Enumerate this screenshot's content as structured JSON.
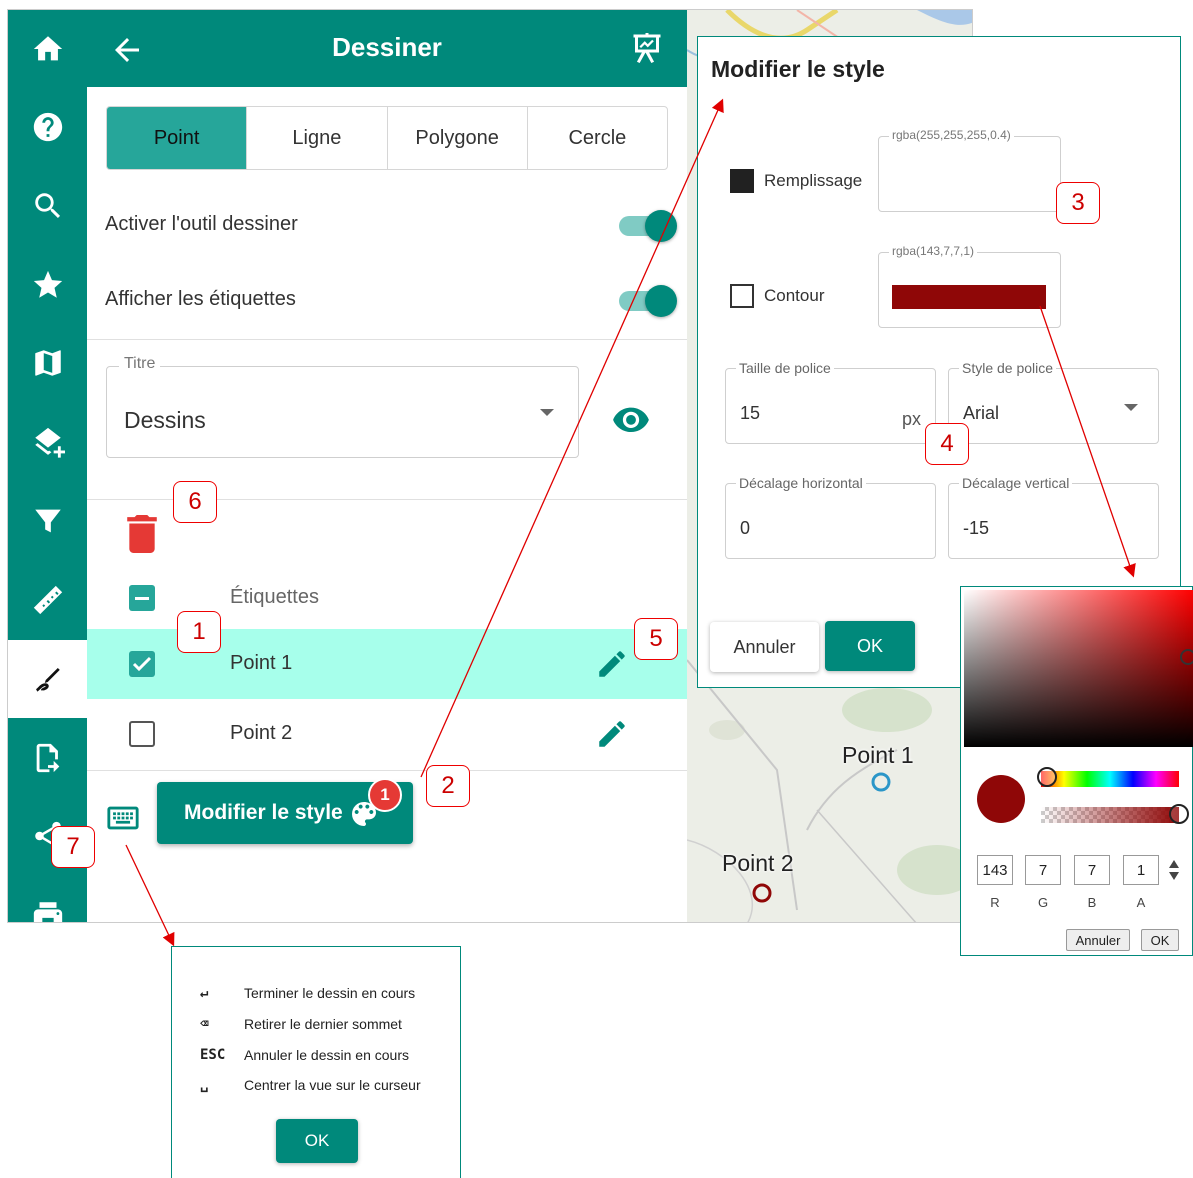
{
  "header": {
    "title": "Dessiner"
  },
  "tabs": [
    {
      "label": "Point",
      "active": true
    },
    {
      "label": "Ligne",
      "active": false
    },
    {
      "label": "Polygone",
      "active": false
    },
    {
      "label": "Cercle",
      "active": false
    }
  ],
  "toggles": {
    "draw_tool": {
      "label": "Activer l'outil dessiner",
      "on": true
    },
    "labels": {
      "label": "Afficher les étiquettes",
      "on": true
    }
  },
  "layer_select": {
    "legend": "Titre",
    "value": "Dessins"
  },
  "list": {
    "header": "Étiquettes",
    "items": [
      {
        "label": "Point 1",
        "checked": true,
        "selected": true
      },
      {
        "label": "Point 2",
        "checked": false,
        "selected": false
      }
    ]
  },
  "style_button": {
    "label": "Modifier le style",
    "badge": "1"
  },
  "map": {
    "labels": [
      "Point 1",
      "Point 2"
    ]
  },
  "style_dialog": {
    "title": "Modifier le style",
    "fill": {
      "label": "Remplissage",
      "value": "rgba(255,255,255,0.4)"
    },
    "stroke": {
      "label": "Contour",
      "value": "rgba(143,7,7,1)",
      "color": "#8f0707"
    },
    "font_size": {
      "legend": "Taille de police",
      "value": "15",
      "suffix": "px"
    },
    "font_style": {
      "legend": "Style de police",
      "value": "Arial"
    },
    "offset_x": {
      "legend": "Décalage horizontal",
      "value": "0"
    },
    "offset_y": {
      "legend": "Décalage vertical",
      "value": "-15"
    },
    "cancel_label": "Annuler",
    "ok_label": "OK"
  },
  "color_picker": {
    "r": "143",
    "g": "7",
    "b": "7",
    "a": "1",
    "r_label": "R",
    "g_label": "G",
    "b_label": "B",
    "a_label": "A",
    "cancel_label": "Annuler",
    "ok_label": "OK"
  },
  "shortcuts": {
    "items": [
      {
        "key": "↵",
        "text": "Terminer le dessin en cours"
      },
      {
        "key": "⌫",
        "text": "Retirer le dernier sommet"
      },
      {
        "key": "ESC",
        "text": "Annuler le dessin en cours"
      },
      {
        "key": "␣",
        "text": "Centrer la vue sur le curseur"
      }
    ],
    "ok_label": "OK"
  },
  "callouts": [
    "1",
    "2",
    "3",
    "4",
    "5",
    "6",
    "7"
  ],
  "colors": {
    "primary": "#00897b",
    "primary_light": "#26a69a",
    "selected_row": "#a7ffeb",
    "danger": "#e53935",
    "annotation": "#e00000"
  },
  "rail_icons": [
    "home-icon",
    "help-icon",
    "search-icon",
    "star-icon",
    "map-icon",
    "add-layer-icon",
    "filter-icon",
    "ruler-icon",
    "draw-icon",
    "import-icon",
    "share-icon",
    "print-icon"
  ]
}
